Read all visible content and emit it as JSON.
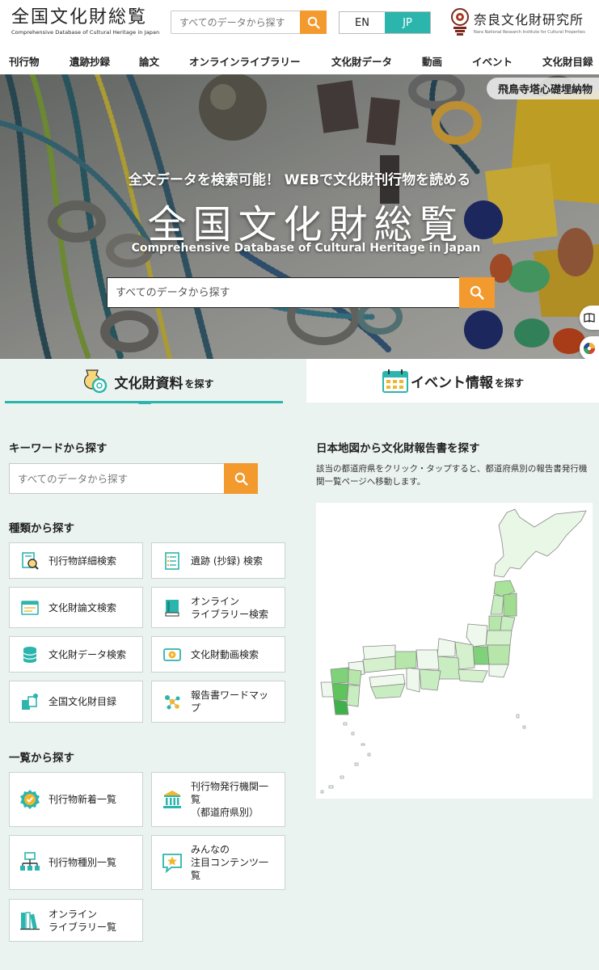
{
  "header": {
    "logo_title": "全国文化財総覧",
    "logo_subtitle": "Comprehensive Database of Cultural Heritage in Japan",
    "search_placeholder": "すべてのデータから探す",
    "lang_en": "EN",
    "lang_jp": "JP",
    "lang_active": "JP",
    "institute_name": "奈良文化財研究所",
    "institute_en": "Nara National Research Institute for Cultural Properties"
  },
  "nav": {
    "items": [
      {
        "label": "刊行物"
      },
      {
        "label": "遺跡抄録"
      },
      {
        "label": "論文"
      },
      {
        "label": "オンラインライブラリー"
      },
      {
        "label": "文化財データ"
      },
      {
        "label": "動画"
      },
      {
        "label": "イベント"
      },
      {
        "label": "文化財目録"
      }
    ]
  },
  "hero": {
    "tag": "飛鳥寺塔心礎埋納物",
    "catch": "全文データを検索可能！ WEBで文化財刊行物を読める",
    "title": "全国文化財総覧",
    "subtitle": "Comprehensive Database of Cultural Heritage in Japan",
    "search_placeholder": "すべてのデータから探す"
  },
  "tabs": {
    "left_big": "文化財資料",
    "left_small": "を探す",
    "right_big": "イベント情報",
    "right_small": "を探す"
  },
  "keyword": {
    "heading": "キーワードから探す",
    "placeholder": "すべてのデータから探す"
  },
  "types": {
    "heading": "種類から探す",
    "items": [
      {
        "label": "刊行物詳細検索",
        "icon": "magnifier-document-icon"
      },
      {
        "label": "遺跡 (抄録) 検索",
        "icon": "list-document-icon"
      },
      {
        "label": "文化財論文検索",
        "icon": "paper-icon"
      },
      {
        "label": "オンライン\nライブラリー検索",
        "icon": "book-icon"
      },
      {
        "label": "文化財データ検索",
        "icon": "database-icon"
      },
      {
        "label": "文化財動画検索",
        "icon": "video-icon"
      },
      {
        "label": "全国文化財目録",
        "icon": "catalog-icon"
      },
      {
        "label": "報告書ワードマッ\nプ",
        "icon": "word-map-icon"
      }
    ]
  },
  "lists": {
    "heading": "一覧から探す",
    "items": [
      {
        "label": "刊行物新着一覧",
        "icon": "new-badge-icon"
      },
      {
        "label": "刊行物発行機関一\n覧\n（都道府県別）",
        "icon": "institution-icon"
      },
      {
        "label": "刊行物種別一覧",
        "icon": "hierarchy-icon"
      },
      {
        "label": "みんなの\n注目コンテンツ一\n覧",
        "icon": "star-bubble-icon"
      },
      {
        "label": "オンライン\nライブラリー覧",
        "icon": "books-icon"
      }
    ]
  },
  "map": {
    "heading": "日本地図から文化財報告書を探す",
    "description": "該当の都道府県をクリック・タップすると、都道府県別の報告書発行機関一覧ページへ移動します。"
  },
  "colors": {
    "accent": "#2bb5ad",
    "search_button": "#f29a2e",
    "section_bg": "#ebf3f0"
  }
}
